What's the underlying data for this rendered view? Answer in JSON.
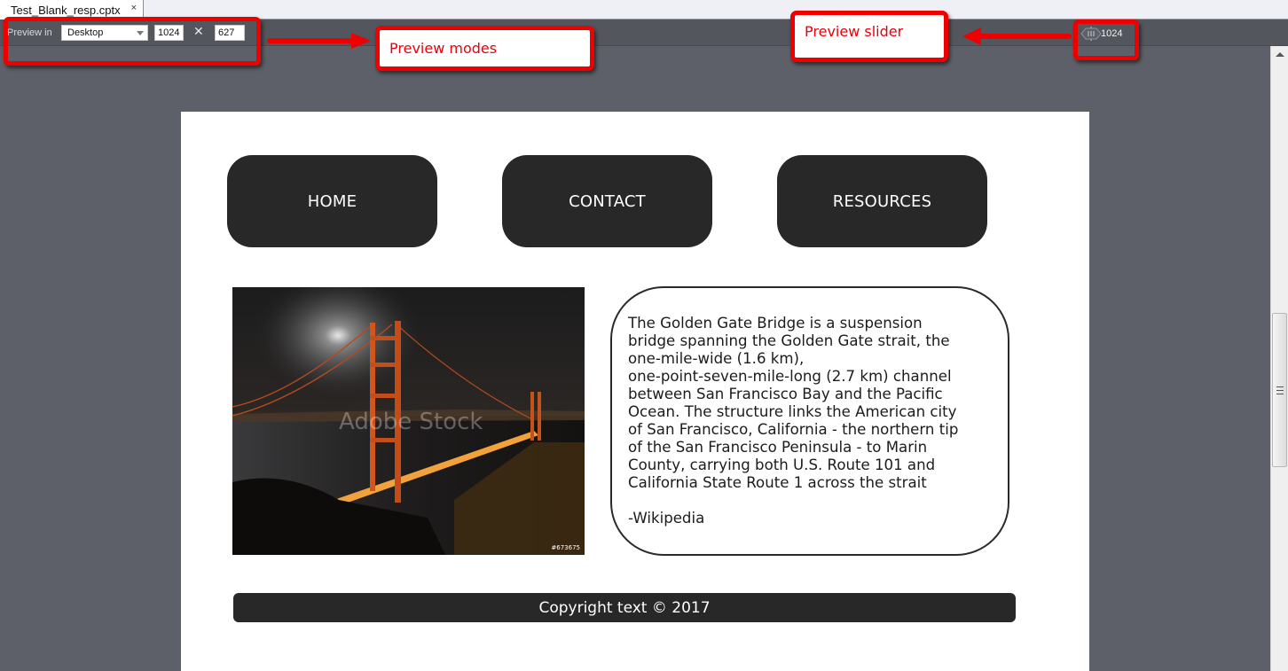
{
  "tab": {
    "title": "Test_Blank_resp.cptx",
    "close_glyph": "×"
  },
  "toolbar": {
    "preview_label": "Preview in",
    "mode_selected": "Desktop",
    "width_value": "1024",
    "height_value": "627",
    "times_glyph": "✕",
    "slider_value": "1024"
  },
  "annotations": {
    "preview_modes": "Preview modes",
    "preview_slider": "Preview slider",
    "accent_color": "#ee0000"
  },
  "page": {
    "nav": [
      {
        "label": "HOME"
      },
      {
        "label": "CONTACT"
      },
      {
        "label": "RESOURCES"
      }
    ],
    "image": {
      "alt": "Golden Gate Bridge at night",
      "watermark": "Adobe Stock",
      "stock_id": "#673675"
    },
    "description": "The Golden Gate Bridge is a suspension bridge spanning the Golden Gate strait, the one-mile-wide (1.6 km), one-point-seven-mile-long (2.7 km) channel between San Francisco Bay and the Pacific Ocean. The structure links the American city of San Francisco, California - the northern tip of the San Francisco Peninsula - to Marin County, carrying both U.S. Route 101 and California State Route 1 across the strait",
    "description_lines": [
      "The Golden Gate Bridge is a suspension",
      "bridge spanning the Golden Gate strait, the",
      "one-mile-wide (1.6 km),",
      "one-point-seven-mile-long (2.7 km) channel",
      "between San Francisco Bay and the Pacific",
      "Ocean. The structure links the American city",
      "of San Francisco, California - the northern tip",
      "of the San Francisco Peninsula - to Marin",
      "County, carrying both U.S. Route 101 and",
      "California State Route 1 across the strait"
    ],
    "attribution": "-Wikipedia",
    "footer": "Copyright text © 2017"
  }
}
